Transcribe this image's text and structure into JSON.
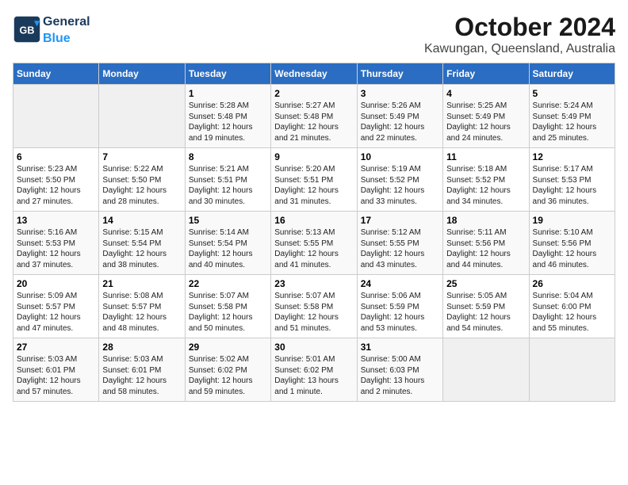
{
  "logo": {
    "general": "General",
    "blue": "Blue"
  },
  "title": "October 2024",
  "subtitle": "Kawungan, Queensland, Australia",
  "days_of_week": [
    "Sunday",
    "Monday",
    "Tuesday",
    "Wednesday",
    "Thursday",
    "Friday",
    "Saturday"
  ],
  "weeks": [
    [
      {
        "day": "",
        "sunrise": "",
        "sunset": "",
        "daylight": ""
      },
      {
        "day": "",
        "sunrise": "",
        "sunset": "",
        "daylight": ""
      },
      {
        "day": "1",
        "sunrise": "Sunrise: 5:28 AM",
        "sunset": "Sunset: 5:48 PM",
        "daylight": "Daylight: 12 hours and 19 minutes."
      },
      {
        "day": "2",
        "sunrise": "Sunrise: 5:27 AM",
        "sunset": "Sunset: 5:48 PM",
        "daylight": "Daylight: 12 hours and 21 minutes."
      },
      {
        "day": "3",
        "sunrise": "Sunrise: 5:26 AM",
        "sunset": "Sunset: 5:49 PM",
        "daylight": "Daylight: 12 hours and 22 minutes."
      },
      {
        "day": "4",
        "sunrise": "Sunrise: 5:25 AM",
        "sunset": "Sunset: 5:49 PM",
        "daylight": "Daylight: 12 hours and 24 minutes."
      },
      {
        "day": "5",
        "sunrise": "Sunrise: 5:24 AM",
        "sunset": "Sunset: 5:49 PM",
        "daylight": "Daylight: 12 hours and 25 minutes."
      }
    ],
    [
      {
        "day": "6",
        "sunrise": "Sunrise: 5:23 AM",
        "sunset": "Sunset: 5:50 PM",
        "daylight": "Daylight: 12 hours and 27 minutes."
      },
      {
        "day": "7",
        "sunrise": "Sunrise: 5:22 AM",
        "sunset": "Sunset: 5:50 PM",
        "daylight": "Daylight: 12 hours and 28 minutes."
      },
      {
        "day": "8",
        "sunrise": "Sunrise: 5:21 AM",
        "sunset": "Sunset: 5:51 PM",
        "daylight": "Daylight: 12 hours and 30 minutes."
      },
      {
        "day": "9",
        "sunrise": "Sunrise: 5:20 AM",
        "sunset": "Sunset: 5:51 PM",
        "daylight": "Daylight: 12 hours and 31 minutes."
      },
      {
        "day": "10",
        "sunrise": "Sunrise: 5:19 AM",
        "sunset": "Sunset: 5:52 PM",
        "daylight": "Daylight: 12 hours and 33 minutes."
      },
      {
        "day": "11",
        "sunrise": "Sunrise: 5:18 AM",
        "sunset": "Sunset: 5:52 PM",
        "daylight": "Daylight: 12 hours and 34 minutes."
      },
      {
        "day": "12",
        "sunrise": "Sunrise: 5:17 AM",
        "sunset": "Sunset: 5:53 PM",
        "daylight": "Daylight: 12 hours and 36 minutes."
      }
    ],
    [
      {
        "day": "13",
        "sunrise": "Sunrise: 5:16 AM",
        "sunset": "Sunset: 5:53 PM",
        "daylight": "Daylight: 12 hours and 37 minutes."
      },
      {
        "day": "14",
        "sunrise": "Sunrise: 5:15 AM",
        "sunset": "Sunset: 5:54 PM",
        "daylight": "Daylight: 12 hours and 38 minutes."
      },
      {
        "day": "15",
        "sunrise": "Sunrise: 5:14 AM",
        "sunset": "Sunset: 5:54 PM",
        "daylight": "Daylight: 12 hours and 40 minutes."
      },
      {
        "day": "16",
        "sunrise": "Sunrise: 5:13 AM",
        "sunset": "Sunset: 5:55 PM",
        "daylight": "Daylight: 12 hours and 41 minutes."
      },
      {
        "day": "17",
        "sunrise": "Sunrise: 5:12 AM",
        "sunset": "Sunset: 5:55 PM",
        "daylight": "Daylight: 12 hours and 43 minutes."
      },
      {
        "day": "18",
        "sunrise": "Sunrise: 5:11 AM",
        "sunset": "Sunset: 5:56 PM",
        "daylight": "Daylight: 12 hours and 44 minutes."
      },
      {
        "day": "19",
        "sunrise": "Sunrise: 5:10 AM",
        "sunset": "Sunset: 5:56 PM",
        "daylight": "Daylight: 12 hours and 46 minutes."
      }
    ],
    [
      {
        "day": "20",
        "sunrise": "Sunrise: 5:09 AM",
        "sunset": "Sunset: 5:57 PM",
        "daylight": "Daylight: 12 hours and 47 minutes."
      },
      {
        "day": "21",
        "sunrise": "Sunrise: 5:08 AM",
        "sunset": "Sunset: 5:57 PM",
        "daylight": "Daylight: 12 hours and 48 minutes."
      },
      {
        "day": "22",
        "sunrise": "Sunrise: 5:07 AM",
        "sunset": "Sunset: 5:58 PM",
        "daylight": "Daylight: 12 hours and 50 minutes."
      },
      {
        "day": "23",
        "sunrise": "Sunrise: 5:07 AM",
        "sunset": "Sunset: 5:58 PM",
        "daylight": "Daylight: 12 hours and 51 minutes."
      },
      {
        "day": "24",
        "sunrise": "Sunrise: 5:06 AM",
        "sunset": "Sunset: 5:59 PM",
        "daylight": "Daylight: 12 hours and 53 minutes."
      },
      {
        "day": "25",
        "sunrise": "Sunrise: 5:05 AM",
        "sunset": "Sunset: 5:59 PM",
        "daylight": "Daylight: 12 hours and 54 minutes."
      },
      {
        "day": "26",
        "sunrise": "Sunrise: 5:04 AM",
        "sunset": "Sunset: 6:00 PM",
        "daylight": "Daylight: 12 hours and 55 minutes."
      }
    ],
    [
      {
        "day": "27",
        "sunrise": "Sunrise: 5:03 AM",
        "sunset": "Sunset: 6:01 PM",
        "daylight": "Daylight: 12 hours and 57 minutes."
      },
      {
        "day": "28",
        "sunrise": "Sunrise: 5:03 AM",
        "sunset": "Sunset: 6:01 PM",
        "daylight": "Daylight: 12 hours and 58 minutes."
      },
      {
        "day": "29",
        "sunrise": "Sunrise: 5:02 AM",
        "sunset": "Sunset: 6:02 PM",
        "daylight": "Daylight: 12 hours and 59 minutes."
      },
      {
        "day": "30",
        "sunrise": "Sunrise: 5:01 AM",
        "sunset": "Sunset: 6:02 PM",
        "daylight": "Daylight: 13 hours and 1 minute."
      },
      {
        "day": "31",
        "sunrise": "Sunrise: 5:00 AM",
        "sunset": "Sunset: 6:03 PM",
        "daylight": "Daylight: 13 hours and 2 minutes."
      },
      {
        "day": "",
        "sunrise": "",
        "sunset": "",
        "daylight": ""
      },
      {
        "day": "",
        "sunrise": "",
        "sunset": "",
        "daylight": ""
      }
    ]
  ]
}
